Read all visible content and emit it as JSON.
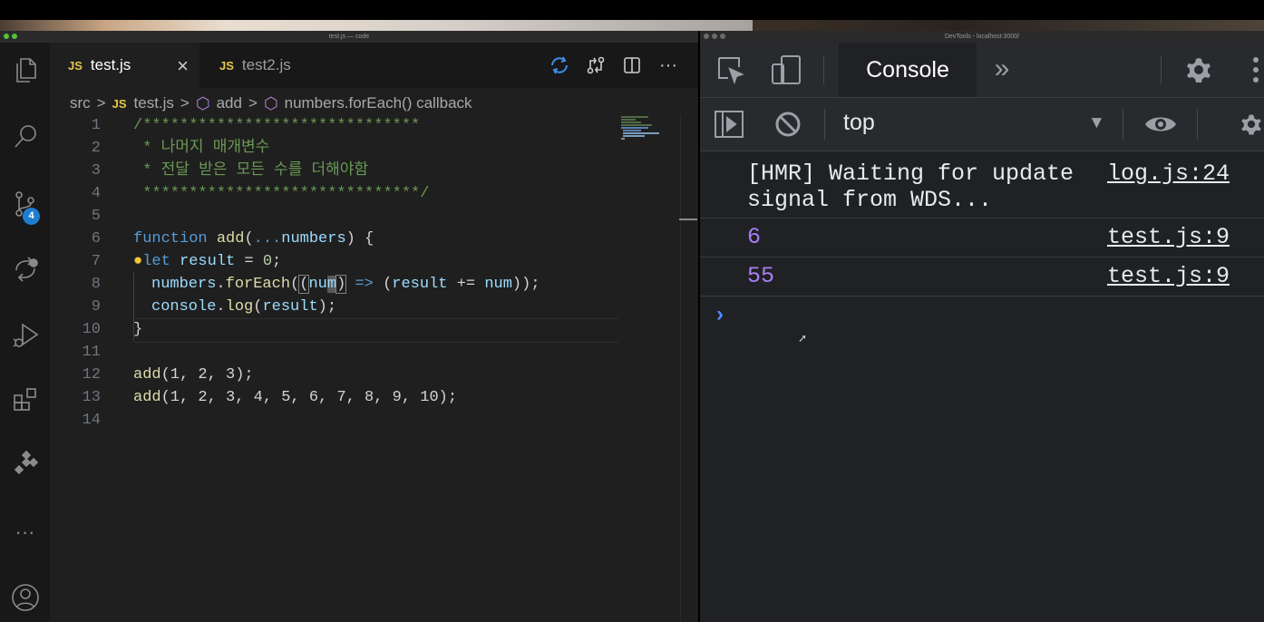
{
  "window": {
    "vscode_title": "test.js — code",
    "devtools_title": "DevTools - localhost:3000/"
  },
  "activity_bar": {
    "source_control_badge": "4",
    "more_label": "···"
  },
  "tabs": [
    {
      "icon": "JS",
      "label": "test.js",
      "active": true,
      "close": "×"
    },
    {
      "icon": "JS",
      "label": "test2.js",
      "active": false
    }
  ],
  "tab_actions": {
    "more": "···"
  },
  "breadcrumb": {
    "folder": "src",
    "file_icon": "JS",
    "file": "test.js",
    "symbol1": "add",
    "symbol2": "numbers.forEach() callback",
    "separator": ">"
  },
  "code": {
    "line_numbers": [
      "1",
      "2",
      "3",
      "4",
      "5",
      "6",
      "7",
      "8",
      "9",
      "10",
      "11",
      "12",
      "13",
      "14"
    ],
    "line1": "/******************************",
    "line2": " * 나머지 매개변수",
    "line3": " * 전달 받은 모든 수를 더해야함",
    "line4": " ******************************/",
    "line6": {
      "kw": "function",
      "fn": "add",
      "open": "(",
      "rest": "...",
      "param": "numbers",
      "close": ") {"
    },
    "line7": {
      "kw": "let",
      "var": "result",
      "eq": " = ",
      "num": "0",
      "end": ";"
    },
    "line8": {
      "obj": "numbers",
      "dot": ".",
      "fn": "forEach",
      "p1": "(",
      "p2": "(",
      "arg1": "nu",
      "arg2": "m",
      "p3": ")",
      "arrow": " => ",
      "p4": "(",
      "var": "result",
      "op": " += ",
      "var2": "num",
      "end": "));"
    },
    "line9": {
      "obj": "console",
      "dot": ".",
      "fn": "log",
      "open": "(",
      "var": "result",
      "end": ");"
    },
    "line10": "}",
    "line12": {
      "fn": "add",
      "args": "(1, 2, 3);"
    },
    "line13": {
      "fn": "add",
      "args": "(1, 2, 3, 4, 5, 6, 7, 8, 9, 10);"
    }
  },
  "devtools": {
    "tab_console": "Console",
    "more_tabs": "»",
    "context": "top",
    "messages": [
      {
        "text": "[HMR] Waiting for update\nsignal from WDS...",
        "source": "log.js:24"
      },
      {
        "text": "6",
        "source": "test.js:9"
      },
      {
        "text": "55",
        "source": "test.js:9"
      }
    ],
    "prompt": "›"
  },
  "colors": {
    "editor_bg": "#1f1f1f",
    "devtools_bg": "#202124",
    "badge": "#1f7dd0",
    "console_number": "#a87ef5"
  }
}
